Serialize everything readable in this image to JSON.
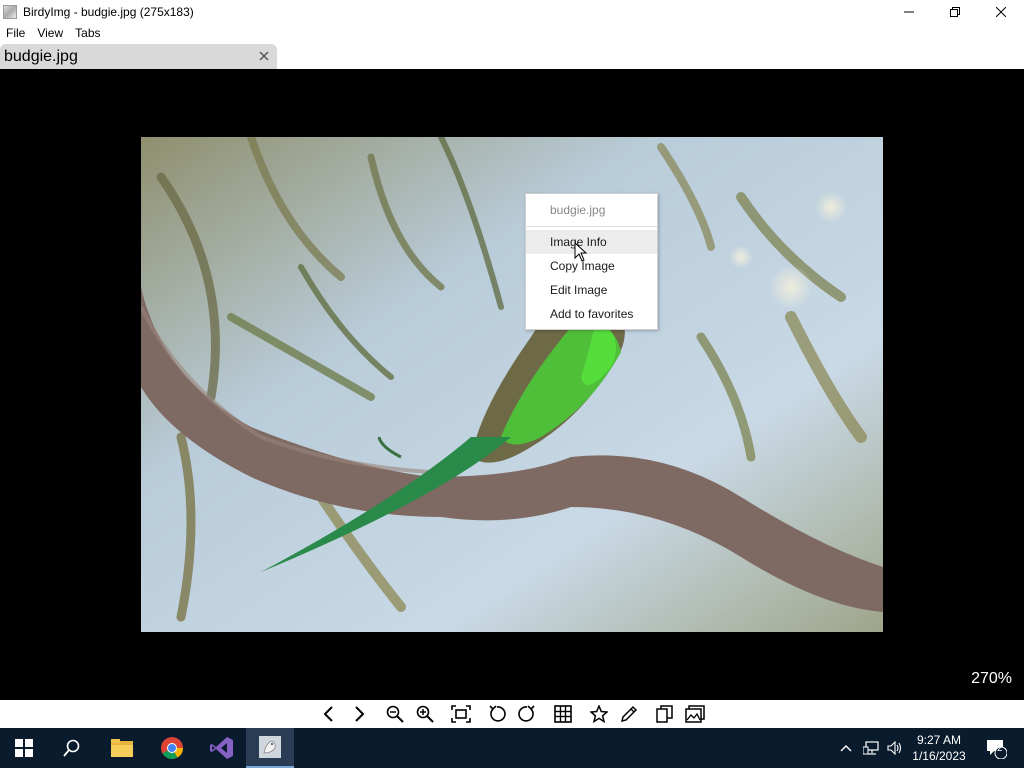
{
  "window": {
    "title": "BirdyImg - budgie.jpg (275x183)"
  },
  "menu": {
    "items": [
      "File",
      "View",
      "Tabs"
    ]
  },
  "tabs": [
    {
      "label": "budgie.jpg"
    }
  ],
  "viewer": {
    "zoom": "270%"
  },
  "context_menu": {
    "header": "budgie.jpg",
    "items": [
      "Image Info",
      "Copy Image",
      "Edit Image",
      "Add to favorites"
    ],
    "hovered": "Image Info"
  },
  "toolbar": {
    "icons": [
      "prev-icon",
      "next-icon",
      "zoom-out-icon",
      "zoom-in-icon",
      "fit-icon",
      "rotate-left-icon",
      "rotate-right-icon",
      "grid-icon",
      "star-icon",
      "pencil-icon",
      "copy-icon",
      "gallery-icon"
    ]
  },
  "taskbar": {
    "apps": [
      "start-icon",
      "search-icon",
      "file-explorer-icon",
      "chrome-icon",
      "visual-studio-icon",
      "birdyimg-icon"
    ],
    "time": "9:27 AM",
    "date": "1/16/2023",
    "notification_count": "2"
  },
  "colors": {
    "viewer_bg": "#000000",
    "taskbar_bg": "#0b1b2e",
    "tab_bg": "#d9d9d9"
  }
}
